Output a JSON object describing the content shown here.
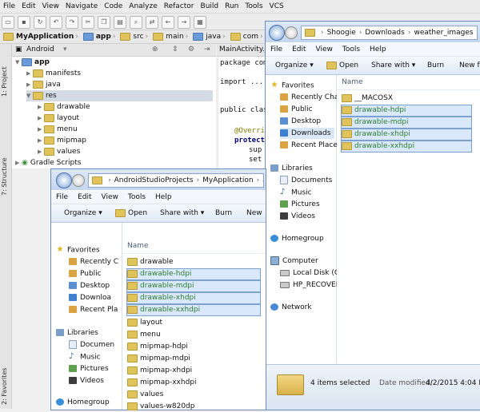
{
  "ide": {
    "menu": [
      "File",
      "Edit",
      "View",
      "Navigate",
      "Code",
      "Analyze",
      "Refactor",
      "Build",
      "Run",
      "Tools",
      "VCS"
    ],
    "breadcrumb": [
      "MyApplication",
      "app",
      "src",
      "main",
      "java",
      "com",
      "example"
    ],
    "project_view_label": "Android",
    "side_tabs": [
      "1: Project",
      "7: Structure",
      "2: Favorites"
    ],
    "tree": [
      {
        "label": "app",
        "depth": 0
      },
      {
        "label": "manifests",
        "depth": 1
      },
      {
        "label": "java",
        "depth": 1
      },
      {
        "label": "res",
        "depth": 1
      },
      {
        "label": "drawable",
        "depth": 2
      },
      {
        "label": "layout",
        "depth": 2
      },
      {
        "label": "menu",
        "depth": 2
      },
      {
        "label": "mipmap",
        "depth": 2
      },
      {
        "label": "values",
        "depth": 2
      },
      {
        "label": "Gradle Scripts",
        "depth": 0
      }
    ],
    "editor_tab": "MainActivity.ja",
    "code": [
      "package com",
      "import ...",
      "public clas",
      "@Overri",
      "protect",
      "sup",
      "set"
    ]
  },
  "win_back": {
    "address": [
      "Shoogie",
      "Downloads",
      "weather_images"
    ],
    "menu": [
      "File",
      "Edit",
      "View",
      "Tools",
      "Help"
    ],
    "commands": {
      "organize": "Organize",
      "open": "Open",
      "share": "Share with",
      "burn": "Burn",
      "new_folder": "New fo"
    },
    "column_name": "Name",
    "nav": {
      "favorites": "Favorites",
      "fav_items": [
        "Recently Cha",
        "Public",
        "Desktop",
        "Downloads",
        "Recent Places"
      ],
      "libraries": "Libraries",
      "lib_items": [
        "Documents",
        "Music",
        "Pictures",
        "Videos"
      ],
      "homegroup": "Homegroup",
      "computer": "Computer",
      "comp_items": [
        "Local Disk (C:)",
        "HP_RECOVER"
      ],
      "network": "Network"
    },
    "files": [
      {
        "name": "__MACOSX",
        "selected": false
      },
      {
        "name": "drawable-hdpi",
        "selected": true
      },
      {
        "name": "drawable-mdpi",
        "selected": true
      },
      {
        "name": "drawable-xhdpi",
        "selected": true
      },
      {
        "name": "drawable-xxhdpi",
        "selected": true
      }
    ],
    "status": {
      "count": "4 items selected",
      "modified_label": "Date modified:",
      "modified_value": "4/2/2015 4:04 PM"
    }
  },
  "win_front": {
    "address": [
      "AndroidStudioProjects",
      "MyApplication",
      "ap"
    ],
    "menu": [
      "File",
      "Edit",
      "View",
      "Tools",
      "Help"
    ],
    "commands": {
      "organize": "Organize",
      "open": "Open",
      "share": "Share with",
      "burn": "Burn",
      "new_folder": "New"
    },
    "column_name": "Name",
    "nav": {
      "favorites": "Favorites",
      "fav_items": [
        "Recently C",
        "Public",
        "Desktop",
        "Downloa",
        "Recent Pla"
      ],
      "libraries": "Libraries",
      "lib_items": [
        "Documen",
        "Music",
        "Pictures",
        "Videos"
      ],
      "homegroup": "Homegroup"
    },
    "files": [
      {
        "name": "drawable",
        "selected": false
      },
      {
        "name": "drawable-hdpi",
        "selected": true
      },
      {
        "name": "drawable-mdpi",
        "selected": true
      },
      {
        "name": "drawable-xhdpi",
        "selected": true
      },
      {
        "name": "drawable-xxhdpi",
        "selected": true
      },
      {
        "name": "layout",
        "selected": false
      },
      {
        "name": "menu",
        "selected": false
      },
      {
        "name": "mipmap-hdpi",
        "selected": false
      },
      {
        "name": "mipmap-mdpi",
        "selected": false
      },
      {
        "name": "mipmap-xhdpi",
        "selected": false
      },
      {
        "name": "mipmap-xxhdpi",
        "selected": false
      },
      {
        "name": "values",
        "selected": false
      },
      {
        "name": "values-w820dp",
        "selected": false
      }
    ]
  }
}
